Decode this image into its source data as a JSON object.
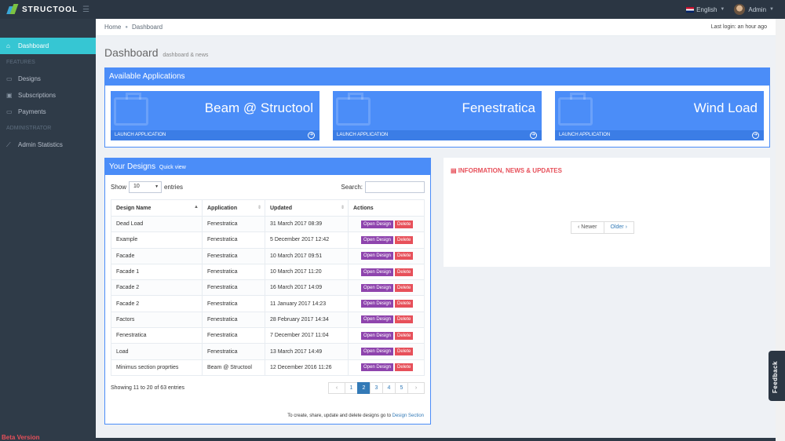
{
  "topbar": {
    "brand": "STRUCTOOL",
    "language": "English",
    "user": "Admin"
  },
  "sidebar": {
    "items": [
      {
        "label": "Dashboard",
        "icon": "home-icon"
      },
      {
        "heading": "FEATURES"
      },
      {
        "label": "Designs",
        "icon": "folder-icon"
      },
      {
        "label": "Subscriptions",
        "icon": "briefcase-icon"
      },
      {
        "label": "Payments",
        "icon": "wallet-icon"
      },
      {
        "heading": "ADMINISTRATOR"
      },
      {
        "label": "Admin Statistics",
        "icon": "chart-line-icon"
      }
    ],
    "beta_label": "Beta Version"
  },
  "breadcrumb": {
    "home": "Home",
    "current": "Dashboard",
    "last_login": "Last login: an hour ago"
  },
  "page": {
    "title": "Dashboard",
    "subtitle": "dashboard & news"
  },
  "apps_panel": {
    "title": "Available Applications",
    "launch_label": "LAUNCH APPLICATION",
    "apps": [
      "Beam @ Structool",
      "Fenestratica",
      "Wind Load"
    ]
  },
  "designs_panel": {
    "title": "Your Designs",
    "subtitle": "Quick view",
    "show_label": "Show",
    "entries_value": "10",
    "entries_label": "entries",
    "search_label": "Search:",
    "columns": [
      "Design Name",
      "Application",
      "Updated",
      "Actions"
    ],
    "open_label": "Open Design",
    "delete_label": "Delete",
    "rows": [
      [
        "Dead Load",
        "Fenestratica",
        "31 March 2017 08:39"
      ],
      [
        "Example",
        "Fenestratica",
        "5 December 2017 12:42"
      ],
      [
        "Facade",
        "Fenestratica",
        "10 March 2017 09:51"
      ],
      [
        "Facade 1",
        "Fenestratica",
        "10 March 2017 11:20"
      ],
      [
        "Facade 2",
        "Fenestratica",
        "16 March 2017 14:09"
      ],
      [
        "Facade 2",
        "Fenestratica",
        "11 January 2017 14:23"
      ],
      [
        "Factors",
        "Fenestratica",
        "28 February 2017 14:34"
      ],
      [
        "Fenestratica",
        "Fenestratica",
        "7 December 2017 11:04"
      ],
      [
        "Load",
        "Fenestratica",
        "13 March 2017 14:49"
      ],
      [
        "Minimus section proprties",
        "Beam @ Structool",
        "12 December 2016 11:26"
      ]
    ],
    "info": "Showing 11 to 20 of 63 entries",
    "pages": [
      "‹",
      "1",
      "2",
      "3",
      "4",
      "5",
      "›"
    ],
    "active_page": "2",
    "note_text": "To create, share, update and delete designs go to",
    "note_link": "Design Section"
  },
  "news_panel": {
    "title": "INFORMATION, NEWS & UPDATES",
    "newer": "Newer",
    "older": "Older"
  },
  "feedback": "Feedback"
}
